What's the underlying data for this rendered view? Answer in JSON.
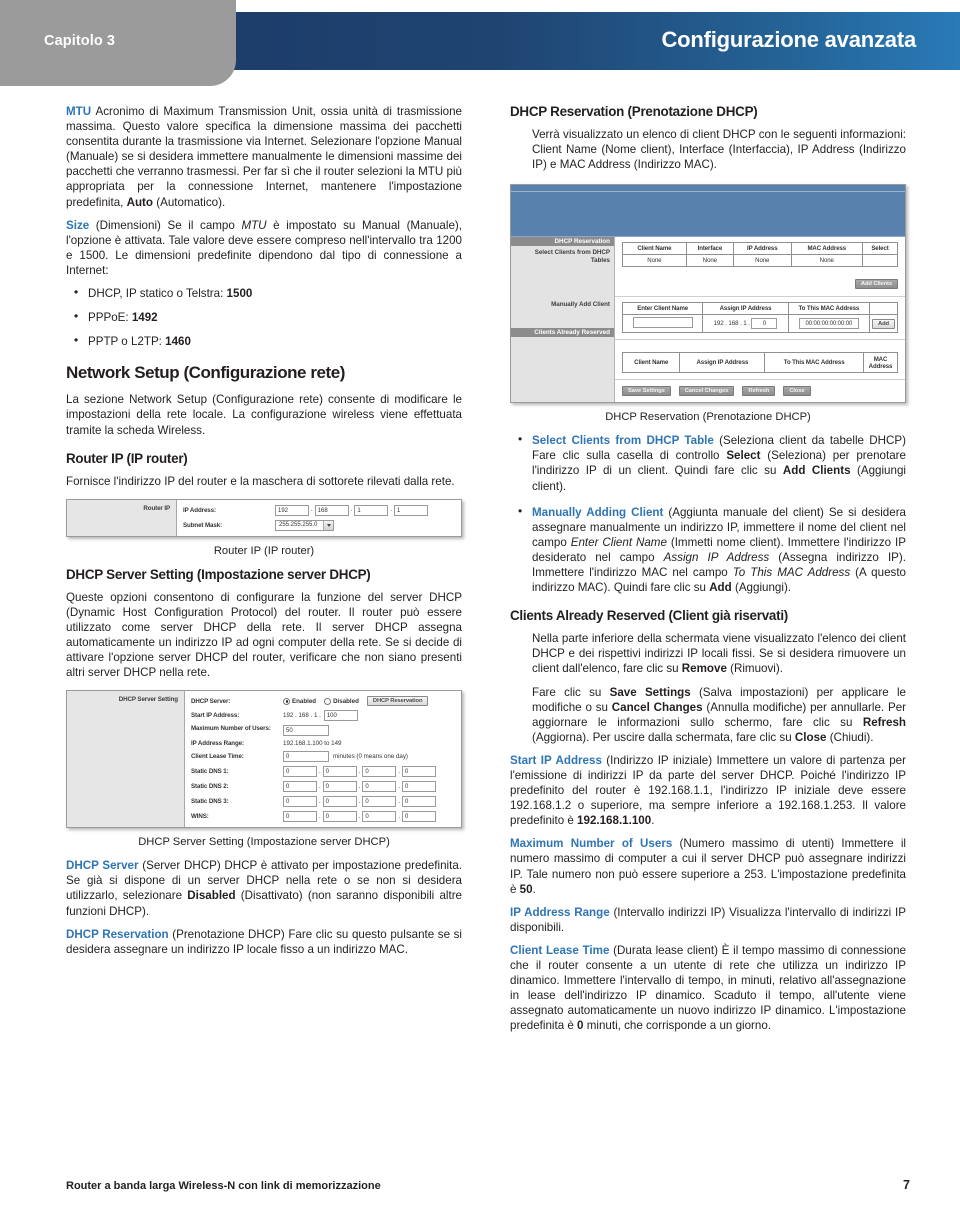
{
  "header": {
    "chapter": "Capitolo 3",
    "title": "Configurazione avanzata"
  },
  "left_column": {
    "mtu_term": "MTU",
    "mtu_text": " Acronimo di Maximum Transmission Unit, ossia unità di trasmissione massima. Questo valore specifica la dimensione massima dei pacchetti consentita durante la trasmissione via Internet. Selezionare l'opzione Manual (Manuale) se si desidera immettere manualmente le dimensioni massime dei pacchetti che verranno trasmessi. Per far sì che il router selezioni la MTU più appropriata per la connessione Internet, mantenere l'impostazione predefinita, ",
    "mtu_bold": "Auto",
    "mtu_text_end": " (Automatico).",
    "size_term": "Size",
    "size_text_1": " (Dimensioni) Se il campo ",
    "size_italic": "MTU",
    "size_text_2": " è impostato su Manual (Manuale), l'opzione è attivata. Tale valore deve essere compreso nell'intervallo tra 1200 e 1500. Le dimensioni predefinite dipendono dal tipo di connessione a Internet:",
    "size_bullets": [
      {
        "label": "DHCP, IP statico o Telstra: ",
        "value": "1500"
      },
      {
        "label": "PPPoE: ",
        "value": "1492"
      },
      {
        "label": "PPTP o L2TP: ",
        "value": "1460"
      }
    ],
    "network_setup_heading": "Network Setup (Configurazione rete)",
    "network_setup_text": "La sezione Network Setup (Configurazione rete) consente di modificare le impostazioni della rete locale. La configurazione wireless viene effettuata tramite la scheda Wireless.",
    "router_ip_heading": "Router IP (IP router)",
    "router_ip_text": "Fornisce l'indirizzo IP del router e la maschera di sottorete rilevati dalla rete.",
    "router_ip_caption": "Router IP (IP router)",
    "dhcp_server_setting_heading": "DHCP Server Setting (Impostazione server DHCP)",
    "dhcp_server_setting_text": "Queste opzioni consentono di configurare la funzione del server DHCP (Dynamic Host Configuration Protocol) del router. Il router può essere utilizzato come server DHCP della rete. Il server DHCP assegna automaticamente un indirizzo IP ad ogni computer della rete. Se si decide di attivare l'opzione server DHCP del router, verificare che non siano presenti altri server DHCP nella rete.",
    "dhcp_server_setting_caption": "DHCP Server Setting (Impostazione server DHCP)",
    "dhcp_server_term": "DHCP Server",
    "dhcp_server_text_1": " (Server DHCP) DHCP è attivato per impostazione predefinita. Se già si dispone di un server DHCP nella rete o se non si desidera utilizzarlo, selezionare ",
    "dhcp_server_bold": "Disabled",
    "dhcp_server_text_2": " (Disattivato) (non saranno disponibili altre funzioni DHCP).",
    "dhcp_reservation_term": "DHCP Reservation",
    "dhcp_reservation_text": " (Prenotazione DHCP) Fare clic su questo pulsante se si desidera assegnare un indirizzo IP locale fisso a un indirizzo MAC."
  },
  "right_column": {
    "dhcp_reservation_heading": "DHCP Reservation (Prenotazione DHCP)",
    "dhcp_reservation_intro": "Verrà visualizzato un elenco di client DHCP con le seguenti informazioni: Client Name (Nome client), Interface (Interfaccia), IP Address (Indirizzo IP) e MAC Address (Indirizzo MAC).",
    "dhcp_reservation_caption": "DHCP Reservation (Prenotazione DHCP)",
    "bullets": [
      {
        "term": "Select Clients from DHCP Table",
        "text_1": " (Seleziona client da tabelle DHCP) Fare clic sulla casella di controllo ",
        "bold_1": "Select",
        "text_2": " (Seleziona) per prenotare l'indirizzo IP di un client. Quindi fare clic su ",
        "bold_2": "Add Clients",
        "text_3": " (Aggiungi client)."
      },
      {
        "term": "Manually Adding Client",
        "text_1": " (Aggiunta manuale del client) Se si desidera assegnare manualmente un indirizzo IP, immettere il nome del client nel campo ",
        "italic_1": "Enter Client Name",
        "text_2": " (Immetti nome client). Immettere l'indirizzo IP desiderato nel campo ",
        "italic_2": "Assign IP Address",
        "text_3": " (Assegna indirizzo IP). Immettere l'indirizzo MAC nel campo ",
        "italic_3": "To This MAC Address",
        "text_4": " (A questo indirizzo MAC). Quindi fare clic su ",
        "bold_1": "Add",
        "text_5": " (Aggiungi)."
      }
    ],
    "clients_reserved_heading": "Clients Already Reserved (Client già riservati)",
    "clients_reserved_text_1": "Nella parte inferiore della schermata viene visualizzato l'elenco dei client DHCP e dei rispettivi indirizzi IP locali fissi. Se si desidera rimuovere un client dall'elenco, fare clic su ",
    "clients_reserved_bold": "Remove",
    "clients_reserved_text_2": " (Rimuovi).",
    "save_text_1": "Fare clic su ",
    "save_bold_1": "Save Settings",
    "save_text_2": " (Salva impostazioni) per applicare le modifiche o su ",
    "save_bold_2": "Cancel Changes",
    "save_text_3": " (Annulla modifiche) per annullarle. Per aggiornare le informazioni sullo schermo, fare clic su ",
    "save_bold_3": "Refresh",
    "save_text_4": " (Aggiorna). Per uscire dalla schermata, fare clic su ",
    "save_bold_4": "Close",
    "save_text_5": " (Chiudi).",
    "start_ip_term": "Start IP Address",
    "start_ip_text_1": " (Indirizzo IP iniziale) Immettere un valore di partenza per l'emissione di indirizzi IP da parte del server DHCP. Poiché l'indirizzo IP predefinito del router è 192.168.1.1, l'indirizzo IP iniziale deve essere 192.168.1.2 o superiore, ma sempre inferiore a 192.168.1.253. Il valore predefinito è ",
    "start_ip_bold": "192.168.1.100",
    "start_ip_text_2": ".",
    "max_users_term": "Maximum Number of Users",
    "max_users_text_1": " (Numero massimo di utenti) Immettere il numero massimo di computer a cui il server DHCP può assegnare indirizzi IP. Tale numero non può essere superiore a 253. L'impostazione predefinita è ",
    "max_users_bold": "50",
    "max_users_text_2": ".",
    "ip_range_term": "IP Address Range",
    "ip_range_text": " (Intervallo indirizzi IP) Visualizza l'intervallo di indirizzi IP disponibili.",
    "lease_time_term": "Client Lease Time",
    "lease_time_text_1": " (Durata lease client) È il tempo massimo di connessione che il router consente a un utente di rete che utilizza un indirizzo IP dinamico. Immettere l'intervallo di tempo, in minuti, relativo all'assegnazione in lease dell'indirizzo IP dinamico. Scaduto il tempo, all'utente viene assegnato automaticamente un nuovo indirizzo IP dinamico. L'impostazione predefinita è ",
    "lease_time_bold": "0",
    "lease_time_text_2": " minuti, che corrisponde a un giorno."
  },
  "figure_router_ip": {
    "section_label": "Router IP",
    "ip_address_label": "IP Address:",
    "ip_octets": [
      "192",
      "168",
      "1",
      "1"
    ],
    "subnet_label": "Subnet Mask:",
    "subnet_value": "255.255.255.0"
  },
  "figure_dhcp_server": {
    "section_label": "DHCP Server Setting",
    "rows": [
      {
        "label": "DHCP Server:",
        "enabled_label": "Enabled",
        "disabled_label": "Disabled",
        "button": "DHCP Reservation"
      },
      {
        "label": "Start IP Address:",
        "prefix": "192 . 168 . 1 .",
        "value": "100"
      },
      {
        "label": "Maximum Number of Users:",
        "value": "50"
      },
      {
        "label": "IP Address Range:",
        "text": "192.168.1.100 to 149"
      },
      {
        "label": "Client Lease Time:",
        "value": "0",
        "suffix": "minutes (0 means one day)"
      },
      {
        "label": "Static DNS 1:",
        "octets": [
          "0",
          "0",
          "0",
          "0"
        ]
      },
      {
        "label": "Static DNS 2:",
        "octets": [
          "0",
          "0",
          "0",
          "0"
        ]
      },
      {
        "label": "Static DNS 3:",
        "octets": [
          "0",
          "0",
          "0",
          "0"
        ]
      },
      {
        "label": "WINS:",
        "octets": [
          "0",
          "0",
          "0",
          "0"
        ]
      }
    ]
  },
  "figure_dhcp_reservation": {
    "section_title": "DHCP Reservation",
    "select_clients_label": "Select Clients from DHCP Tables",
    "table_headers": [
      "Client Name",
      "Interface",
      "IP Address",
      "MAC Address",
      "Select"
    ],
    "table_row": [
      "None",
      "None",
      "None",
      "None",
      ""
    ],
    "add_clients_button": "Add Clients",
    "manually_add_label": "Manually Add Client",
    "manual_headers": [
      "Enter Client Name",
      "Assign IP Address",
      "To This MAC Address"
    ],
    "manual_ip_prefix": "192 . 168 . 1 .",
    "manual_ip_value": "0",
    "manual_mac_value": "00:00:00:00:00:00",
    "add_button": "Add",
    "clients_reserved_label": "Clients Already Reserved",
    "reserved_headers": [
      "Client Name",
      "Assign IP Address",
      "To This MAC Address",
      "MAC Address"
    ],
    "footer_buttons": [
      "Save Settings",
      "Cancel Changes",
      "Refresh",
      "Close"
    ]
  },
  "footer": {
    "text": "Router a banda larga Wireless-N con link di memorizzazione",
    "page": "7"
  }
}
